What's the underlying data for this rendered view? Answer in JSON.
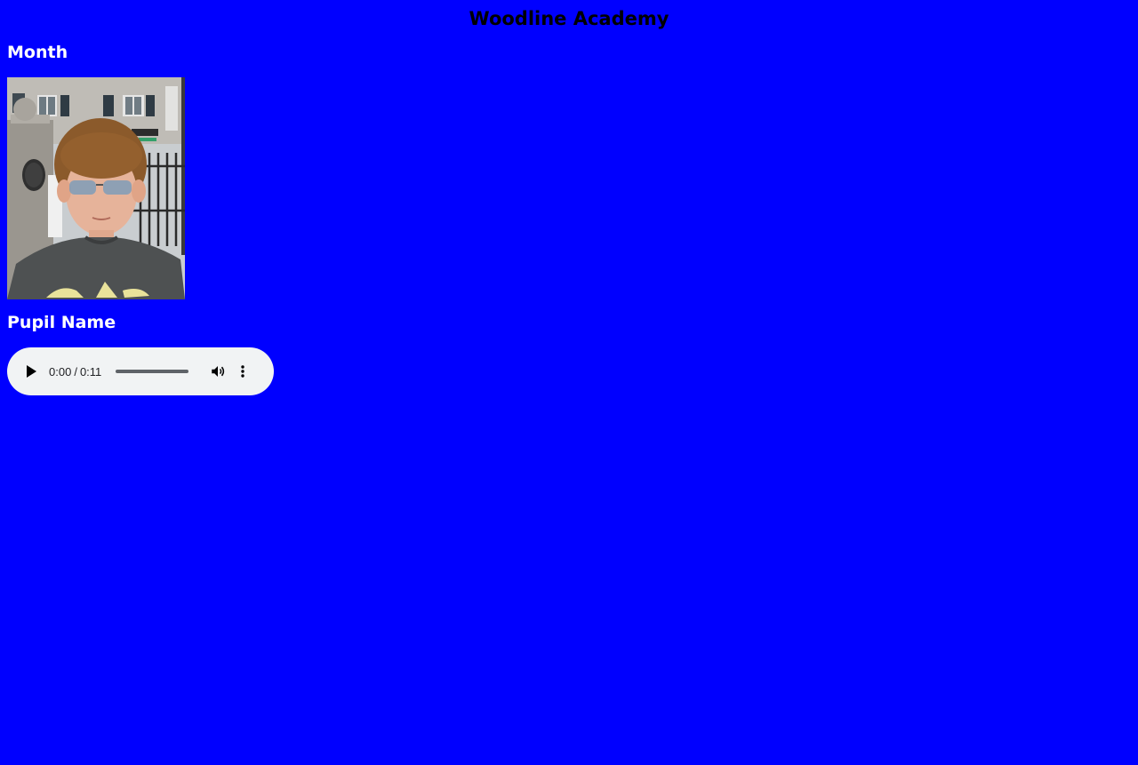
{
  "page": {
    "title": "Woodline Academy",
    "background_color": "#0000ff"
  },
  "month_section": {
    "heading": "Month"
  },
  "photo": {
    "subject": "pupil-portrait-photo"
  },
  "pupil_section": {
    "heading": "Pupil Name"
  },
  "audio": {
    "current_time": "0:00",
    "separator": "/",
    "duration": "0:11",
    "progress_fraction": 0,
    "icons": {
      "play": "play-icon",
      "volume": "volume-icon",
      "more": "more-options-icon"
    }
  }
}
